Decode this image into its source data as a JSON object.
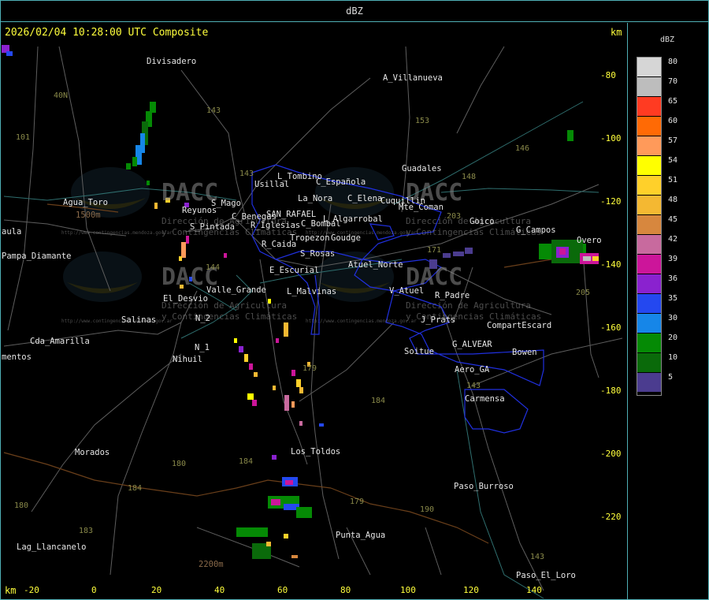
{
  "title": "dBZ",
  "header": {
    "timestamp": "2026/02/04 10:28:00 UTC Composite",
    "km_label_top": "km",
    "km_label_bottom": "km"
  },
  "axes": {
    "y_ticks": [
      "-80",
      "-100",
      "-120",
      "-140",
      "-160",
      "-180",
      "-200",
      "-220"
    ],
    "x_ticks": [
      "-20",
      "0",
      "20",
      "40",
      "60",
      "80",
      "100",
      "120",
      "140"
    ]
  },
  "legend": {
    "title": "dBZ",
    "entries": [
      {
        "value": "80",
        "color": "#d6d6d6"
      },
      {
        "value": "70",
        "color": "#bdbdbd"
      },
      {
        "value": "65",
        "color": "#ff3b22"
      },
      {
        "value": "60",
        "color": "#ff6a05"
      },
      {
        "value": "57",
        "color": "#ff9a5a"
      },
      {
        "value": "54",
        "color": "#ffff00"
      },
      {
        "value": "51",
        "color": "#ffd02a"
      },
      {
        "value": "48",
        "color": "#f4b832"
      },
      {
        "value": "45",
        "color": "#d7873e"
      },
      {
        "value": "42",
        "color": "#c86a9e"
      },
      {
        "value": "39",
        "color": "#cc159a"
      },
      {
        "value": "36",
        "color": "#8a22cf"
      },
      {
        "value": "35",
        "color": "#2448f0"
      },
      {
        "value": "30",
        "color": "#1686e8"
      },
      {
        "value": "20",
        "color": "#058a05"
      },
      {
        "value": "10",
        "color": "#0a6a0a"
      },
      {
        "value": "5",
        "color": "#4b3c8f"
      }
    ]
  },
  "places": [
    "Divisadero",
    "A_Villanueva",
    "Guadales",
    "L_Tombino",
    "Usillal",
    "C_Española",
    "La_Nora",
    "C_Elena",
    "Cuquillin",
    "Mte_Coman",
    "Goico",
    "G_Campos",
    "Overo",
    "Agua_Toro",
    "Reyunos",
    "S_Mago",
    "C_Benegas",
    "SAN_RAFAEL",
    "L_Algarrobal",
    "C_Bombal",
    "R_Iglesias",
    "Tropezon",
    "Goudge",
    "S_Pintada",
    "R_Caida",
    "S_Rosas",
    "Atuel_Norte",
    "E_Escurial",
    "V_Atuel",
    "R_Padre",
    "Valle_Grande",
    "L_Malvinas",
    "El_Desvio",
    "Salinas",
    "N_2",
    "J_Prats",
    "CompartEscard",
    "G_ALVEAR",
    "Soitue",
    "Bowen",
    "Cda_Amarilla",
    "N_1",
    "Nihuil",
    "Aero_GA",
    "Carmensa",
    "mentos",
    "Morados",
    "Los_Toldos",
    "Paso_Burroso",
    "Punta_Agua",
    "Lag_Llancanelo",
    "Paso_El_Loro",
    "aula",
    "Pampa_Diamante",
    "2200m",
    "1500m"
  ],
  "routes": [
    "40N",
    "101",
    "143",
    "153",
    "146",
    "148",
    "143",
    "203",
    "144",
    "171",
    "179",
    "184",
    "180",
    "184",
    "183",
    "184",
    "179",
    "190",
    "143",
    "143",
    "205",
    "180"
  ],
  "watermark": {
    "brand": "DACC",
    "line1": "Dirección de Agricultura",
    "line2": "y Contingencias Climáticas",
    "url": "http://www.contingencias.mendoza.gov.ar"
  }
}
